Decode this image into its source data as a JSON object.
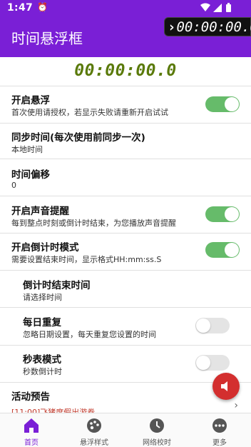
{
  "status_bar": {
    "time": "1:47",
    "alarm_icon": "alarm-icon",
    "icons": "▾ ◢ ▮"
  },
  "app_bar": {
    "title": "时间悬浮框"
  },
  "float_timer": {
    "arrow": "›",
    "value": "00:00:00.0"
  },
  "clock": {
    "value": "00:00:00.0",
    "color": "#5a7a0a"
  },
  "settings": {
    "floating": {
      "title": "开启悬浮",
      "subtitle": "首次使用请授权，若显示失败请重新开启试试",
      "enabled": true
    },
    "sync": {
      "title": "同步时间(每次使用前同步一次)",
      "subtitle": "本地时间"
    },
    "offset": {
      "title": "时间偏移",
      "value": "0"
    },
    "sound": {
      "title": "开启声音提醒",
      "subtitle": "每到整点时刻或倒计时结束，为您播放声音提醒",
      "enabled": true
    },
    "countdown": {
      "title": "开启倒计时模式",
      "subtitle": "需要设置结束时间，显示格式HH:mm:ss.S",
      "enabled": true
    },
    "countdown_end": {
      "title": "倒计时结束时间",
      "subtitle": "请选择时间"
    },
    "daily_repeat": {
      "title": "每日重复",
      "subtitle": "忽略日期设置，每天重复您设置的时间",
      "enabled": false
    },
    "stopwatch": {
      "title": "秒表模式",
      "subtitle": "秒数倒计时",
      "enabled": false
    },
    "events": {
      "title": "活动预告",
      "subtitle": "[11:00]飞猪度假出游券"
    }
  },
  "bottom_nav": {
    "items": [
      {
        "label": "首页",
        "icon": "home-icon",
        "active": true
      },
      {
        "label": "悬浮样式",
        "icon": "palette-icon",
        "active": false
      },
      {
        "label": "网络校时",
        "icon": "clock-icon",
        "active": false
      },
      {
        "label": "更多",
        "icon": "more-icon",
        "active": false
      }
    ]
  },
  "colors": {
    "primary": "#7a1fd6",
    "toggle_on": "#66bb6a",
    "fab": "#d32f2f"
  }
}
